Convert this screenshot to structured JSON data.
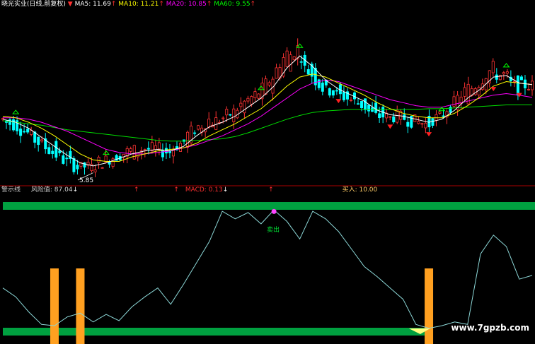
{
  "header": {
    "title": "晓光实业(日线,前复权)",
    "ma": [
      {
        "label": "MA5: 11.69",
        "color": "#ffffff",
        "arrow": "↑"
      },
      {
        "label": "MA10: 11.21",
        "color": "#ffff00",
        "arrow": "↑"
      },
      {
        "label": "MA20: 10.85",
        "color": "#ff00ff",
        "arrow": "↑"
      },
      {
        "label": "MA60: 9.55",
        "color": "#00ff00",
        "arrow": "↑"
      }
    ]
  },
  "indicator_header": {
    "title": "警示线",
    "risk": "风险值: 87.04",
    "macd": "MACD: 0.13",
    "buy": "买入: 10.00"
  },
  "low_label": "5.85",
  "sell_label": "卖出",
  "watermark": "www.7gpzb.com",
  "colors": {
    "up": "#ff3333",
    "down": "#00ffff",
    "band": "#00a040",
    "bar": "#ffa020",
    "line": "#8cd7d7"
  },
  "chart_data": [
    {
      "type": "candlestick",
      "title": "晓光实业(日线,前复权)",
      "low_marker": 5.85,
      "series": [
        {
          "name": "MA5",
          "values": [
            9.4,
            9.2,
            8.8,
            8.2,
            7.6,
            7.0,
            6.5,
            6.3,
            6.5,
            6.8,
            7.1,
            7.3,
            7.4,
            7.3,
            7.6,
            8.3,
            8.9,
            9.2,
            9.6,
            10.2,
            10.8,
            11.6,
            12.8,
            13.6,
            12.9,
            12.0,
            11.4,
            11.0,
            10.6,
            10.0,
            9.7,
            9.6,
            9.4,
            9.2,
            9.4,
            10.0,
            10.8,
            11.4,
            12.2,
            12.3,
            11.8,
            11.7
          ]
        },
        {
          "name": "MA10",
          "values": [
            9.6,
            9.5,
            9.2,
            8.8,
            8.3,
            7.7,
            7.1,
            6.7,
            6.6,
            6.6,
            6.9,
            7.1,
            7.3,
            7.4,
            7.5,
            7.8,
            8.3,
            8.7,
            9.1,
            9.6,
            10.1,
            10.8,
            11.6,
            12.2,
            12.4,
            12.2,
            11.8,
            11.4,
            11.0,
            10.5,
            10.1,
            9.8,
            9.6,
            9.5,
            9.5,
            9.8,
            10.3,
            10.9,
            11.6,
            11.9,
            11.8,
            11.7
          ]
        },
        {
          "name": "MA20",
          "values": [
            9.5,
            9.5,
            9.4,
            9.2,
            8.9,
            8.6,
            8.2,
            7.8,
            7.4,
            7.2,
            7.1,
            7.1,
            7.2,
            7.3,
            7.5,
            7.7,
            8.0,
            8.3,
            8.7,
            9.1,
            9.6,
            10.2,
            10.8,
            11.4,
            11.8,
            12.0,
            11.9,
            11.6,
            11.3,
            11.0,
            10.7,
            10.5,
            10.3,
            10.2,
            10.2,
            10.4,
            10.6,
            10.8,
            11.0,
            11.1,
            11.0,
            10.85
          ]
        },
        {
          "name": "MA60",
          "values": [
            9.3,
            9.2,
            9.1,
            9.0,
            8.85,
            8.7,
            8.6,
            8.5,
            8.4,
            8.3,
            8.2,
            8.1,
            8.0,
            7.95,
            7.95,
            8.0,
            8.05,
            8.1,
            8.25,
            8.5,
            8.8,
            9.1,
            9.4,
            9.65,
            9.85,
            9.95,
            10.0,
            10.05,
            10.05,
            10.05,
            10.05,
            10.05,
            10.05,
            10.1,
            10.1,
            10.15,
            10.2,
            10.25,
            10.3,
            10.35,
            10.35,
            10.35
          ]
        }
      ]
    },
    {
      "type": "line",
      "title": "警示线",
      "ylim": [
        0,
        100
      ],
      "series": [
        {
          "name": "风险值",
          "values": [
            35,
            28,
            16,
            6,
            5,
            12,
            15,
            8,
            14,
            9,
            20,
            28,
            35,
            22,
            38,
            55,
            72,
            96,
            90,
            95,
            86,
            97,
            88,
            74,
            96,
            90,
            80,
            66,
            52,
            44,
            35,
            26,
            6,
            3,
            5,
            8,
            6,
            62,
            77,
            68,
            42,
            45
          ]
        }
      ],
      "highlight_bars": [
        4,
        6,
        33
      ]
    }
  ]
}
